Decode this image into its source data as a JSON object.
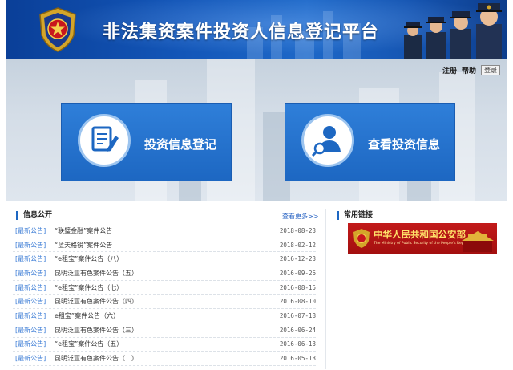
{
  "header": {
    "title": "非法集资案件投资人信息登记平台"
  },
  "top_links": {
    "register": "注册",
    "help": "帮助",
    "login": "登录"
  },
  "actions": {
    "invest_register": "投资信息登记",
    "view_invest": "查看投资信息"
  },
  "news": {
    "section_title": "信息公开",
    "more": "查看更多>>",
    "items": [
      {
        "tag": "[最新公告]",
        "title": "“联璧金融”案件公告",
        "date": "2018-08-23"
      },
      {
        "tag": "[最新公告]",
        "title": "“蓝天格锐”案件公告",
        "date": "2018-02-12"
      },
      {
        "tag": "[最新公告]",
        "title": "“e租宝”案件公告（八）",
        "date": "2016-12-23"
      },
      {
        "tag": "[最新公告]",
        "title": "昆明泛亚有色案件公告（五）",
        "date": "2016-09-26"
      },
      {
        "tag": "[最新公告]",
        "title": "“e租宝”案件公告（七）",
        "date": "2016-08-15"
      },
      {
        "tag": "[最新公告]",
        "title": "昆明泛亚有色案件公告（四）",
        "date": "2016-08-10"
      },
      {
        "tag": "[最新公告]",
        "title": "e租宝”案件公告（六）",
        "date": "2016-07-18"
      },
      {
        "tag": "[最新公告]",
        "title": "昆明泛亚有色案件公告（三）",
        "date": "2016-06-24"
      },
      {
        "tag": "[最新公告]",
        "title": "“e租宝”案件公告（五）",
        "date": "2016-06-13"
      },
      {
        "tag": "[最新公告]",
        "title": "昆明泛亚有色案件公告（二）",
        "date": "2016-05-13"
      }
    ]
  },
  "links": {
    "section_title": "常用链接",
    "mps_name": "中华人民共和国公安部",
    "mps_en": "The Ministry of Public Security of the People's Republic of China"
  },
  "colors": {
    "brand_blue": "#1d67c2",
    "mps_red": "#b31414",
    "tag_blue": "#3a7bd5"
  },
  "icons": {
    "emblem": "police-emblem-icon",
    "register": "document-edit-icon",
    "view": "user-search-icon"
  }
}
